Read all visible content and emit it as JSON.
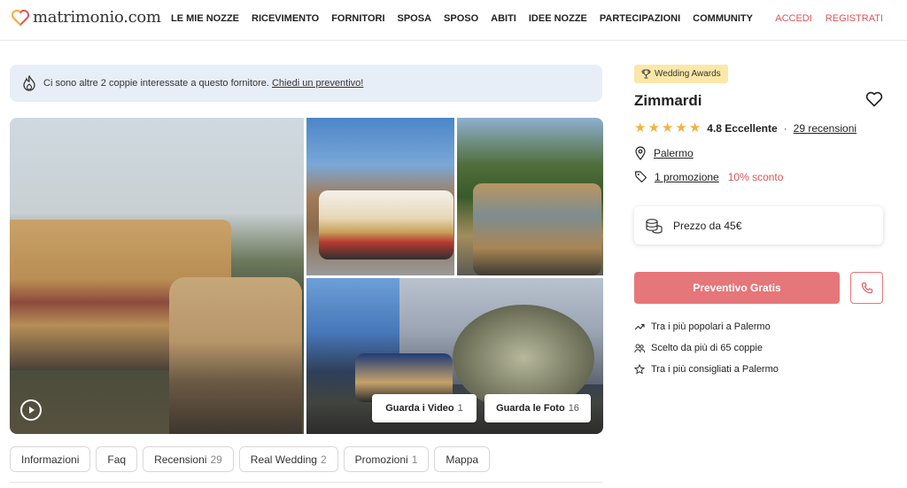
{
  "header": {
    "logo_text": "matrimonio.com",
    "nav": [
      "LE MIE NOZZE",
      "RICEVIMENTO",
      "FORNITORI",
      "SPOSA",
      "SPOSO",
      "ABITI",
      "IDEE NOZZE",
      "PARTECIPAZIONI",
      "COMMUNITY"
    ],
    "login": "ACCEDI",
    "register": "REGISTRATI"
  },
  "banner": {
    "text": "Ci sono altre 2 coppie interessate a questo fornitore.",
    "link": "Chiedi un preventivo!"
  },
  "gallery": {
    "video_label": "Guarda i Video",
    "video_count": "1",
    "photo_label": "Guarda le Foto",
    "photo_count": "16"
  },
  "tabs": [
    {
      "label": "Informazioni",
      "count": ""
    },
    {
      "label": "Faq",
      "count": ""
    },
    {
      "label": "Recensioni",
      "count": "29"
    },
    {
      "label": "Real Wedding",
      "count": "2"
    },
    {
      "label": "Promozioni",
      "count": "1"
    },
    {
      "label": "Mappa",
      "count": ""
    }
  ],
  "vendor": {
    "award": "Wedding Awards",
    "name": "Zimmardi",
    "rating": "4.8 Eccellente",
    "reviews": "29 recensioni",
    "location": "Palermo",
    "promotion": "1 promozione",
    "discount": "10% sconto",
    "price": "Prezzo da 45€",
    "cta": "Preventivo Gratis",
    "features": [
      "Tra i più popolari a Palermo",
      "Scelto da più di 65 coppie",
      "Tra i più consigliati a Palermo"
    ]
  },
  "colors": {
    "accent": "#e0525a",
    "cta": "#e5767a",
    "star": "#f2b33d",
    "award_bg": "#fbe7a8",
    "banner_bg": "#e8eef8"
  }
}
